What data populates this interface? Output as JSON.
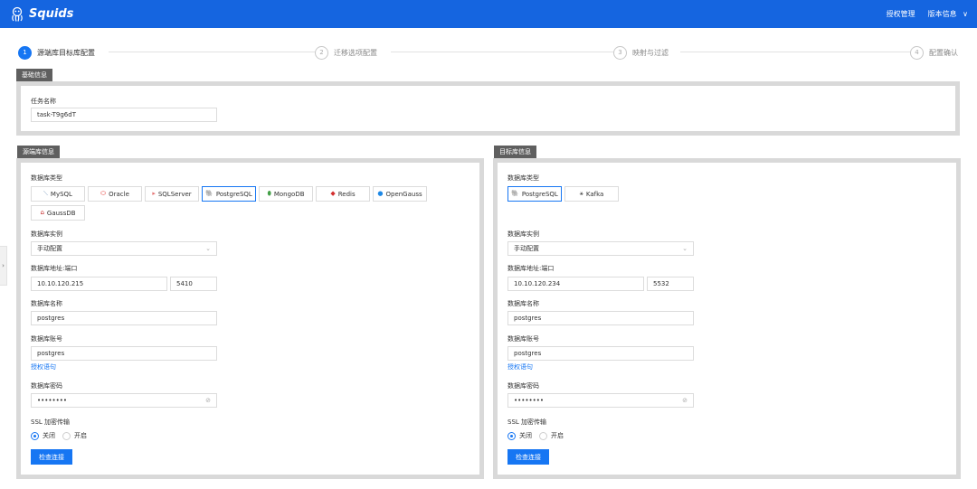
{
  "app": {
    "title": "Squids"
  },
  "topnav": {
    "license": "授权管理",
    "version": "版本信息",
    "version_chevron": "∨"
  },
  "sidetab": {
    "arrow": "›"
  },
  "steps": [
    {
      "num": "1",
      "label": "源端库目标库配置"
    },
    {
      "num": "2",
      "label": "迁移选项配置"
    },
    {
      "num": "3",
      "label": "映射与过滤"
    },
    {
      "num": "4",
      "label": "配置确认"
    }
  ],
  "basic": {
    "section": "基础信息",
    "task_label": "任务名称",
    "task_value": "task-T9g6dT"
  },
  "source": {
    "section": "源端库信息",
    "db_type_label": "数据库类型",
    "db_types": [
      "MySQL",
      "Oracle",
      "SQLServer",
      "PostgreSQL",
      "MongoDB",
      "Redis",
      "OpenGauss",
      "GaussDB"
    ],
    "selected_type": "PostgreSQL",
    "instance_label": "数据库实例",
    "instance_value": "手动配置",
    "addr_label": "数据库地址:端口",
    "host": "10.10.120.215",
    "port": "5410",
    "dbname_label": "数据库名称",
    "dbname": "postgres",
    "account_label": "数据库账号",
    "account": "postgres",
    "grant_link": "授权语句",
    "password_label": "数据库密码",
    "password": "••••••••",
    "ssl_label": "SSL 加密传输",
    "ssl_off": "关闭",
    "ssl_on": "开启",
    "check_button": "检查连接"
  },
  "target": {
    "section": "目标库信息",
    "db_type_label": "数据库类型",
    "db_types": [
      "PostgreSQL",
      "Kafka"
    ],
    "selected_type": "PostgreSQL",
    "instance_label": "数据库实例",
    "instance_value": "手动配置",
    "addr_label": "数据库地址:端口",
    "host": "10.10.120.234",
    "port": "5532",
    "dbname_label": "数据库名称",
    "dbname": "postgres",
    "account_label": "数据库账号",
    "account": "postgres",
    "grant_link": "授权语句",
    "password_label": "数据库密码",
    "password": "••••••••",
    "ssl_label": "SSL 加密传输",
    "ssl_off": "关闭",
    "ssl_on": "开启",
    "check_button": "检查连接"
  },
  "colors": {
    "brand": "#1565e0",
    "accent": "#1676f3"
  }
}
